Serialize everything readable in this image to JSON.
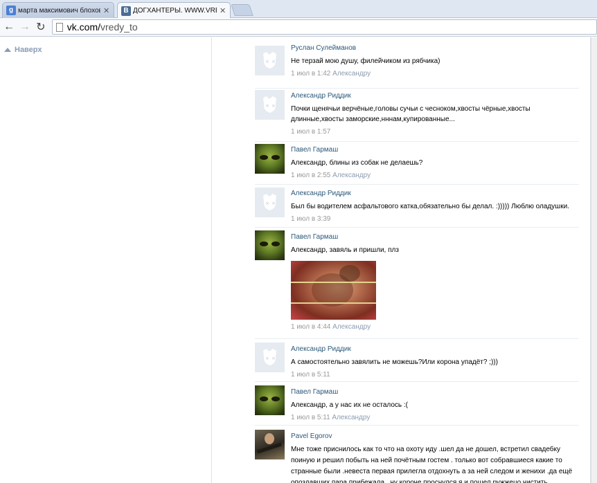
{
  "browser": {
    "tabs": [
      {
        "favicon": "google-icon",
        "favicon_letter": "g",
        "title": "марта максимович блохово",
        "active": false
      },
      {
        "favicon": "vk-icon",
        "favicon_letter": "В",
        "title": "ДОГХАНТЕРЫ. WWW.VRED",
        "active": true
      }
    ],
    "address": {
      "host": "vk.com/",
      "path": "vredy_to"
    }
  },
  "page": {
    "back_to_top_label": "Наверх"
  },
  "comments": [
    {
      "author": "Руслан Сулейманов",
      "avatar": "dog-placeholder-icon",
      "text": "Не терзай мою душу, филейчиком из рябчика)",
      "date": "1 июл в 1:42",
      "reply_to": "Александру"
    },
    {
      "author": "Александр Риддик",
      "avatar": "dog-placeholder-icon",
      "text": "Почки щенячьи верчёные,головы сучьи с чесноком,хвосты чёрные,хвосты длинные,хвосты заморские,нннам,купированные...",
      "date": "1 июл в 1:57",
      "reply_to": ""
    },
    {
      "author": "Павел Гармаш",
      "avatar": "alien-avatar",
      "text": "Александр, блины из собак не делаешь?",
      "date": "1 июл в 2:55",
      "reply_to": "Александру"
    },
    {
      "author": "Александр Риддик",
      "avatar": "dog-placeholder-icon",
      "text": "Был бы водителем асфальтового катка,обязательно бы делал. :))))) Люблю оладушки.",
      "date": "1 июл в 3:39",
      "reply_to": ""
    },
    {
      "author": "Павел Гармаш",
      "avatar": "alien-avatar",
      "text": "Александр, завяль и пришли, плз",
      "date": "1 июл в 4:44",
      "reply_to": "Александру",
      "has_photo": true
    },
    {
      "author": "Александр Риддик",
      "avatar": "dog-placeholder-icon",
      "text": "А самостоятельно завялить не можешь?Или корона упадёт? ;)))",
      "date": "1 июл в 5:11",
      "reply_to": ""
    },
    {
      "author": "Павел Гармаш",
      "avatar": "alien-avatar",
      "text": "Александр, а у нас их не осталось :(",
      "date": "1 июл в 5:11",
      "reply_to": "Александру"
    },
    {
      "author": "Pavel Egorov",
      "avatar": "person-avatar",
      "text": "Мне тоже приснилось как то что на охоту иду .шел да не дошел, встретил свадебку поиную и решил побыть на ней почётным гостем . только вот собравшиеся какие то странные были .невеста первая прилегла отдохнуть а за ней следом и жениxи .да ещё опоздавших пара прибежала . ну короче проснулся я и пошел ружжецо чистить .",
      "date": "",
      "reply_to": ""
    }
  ]
}
